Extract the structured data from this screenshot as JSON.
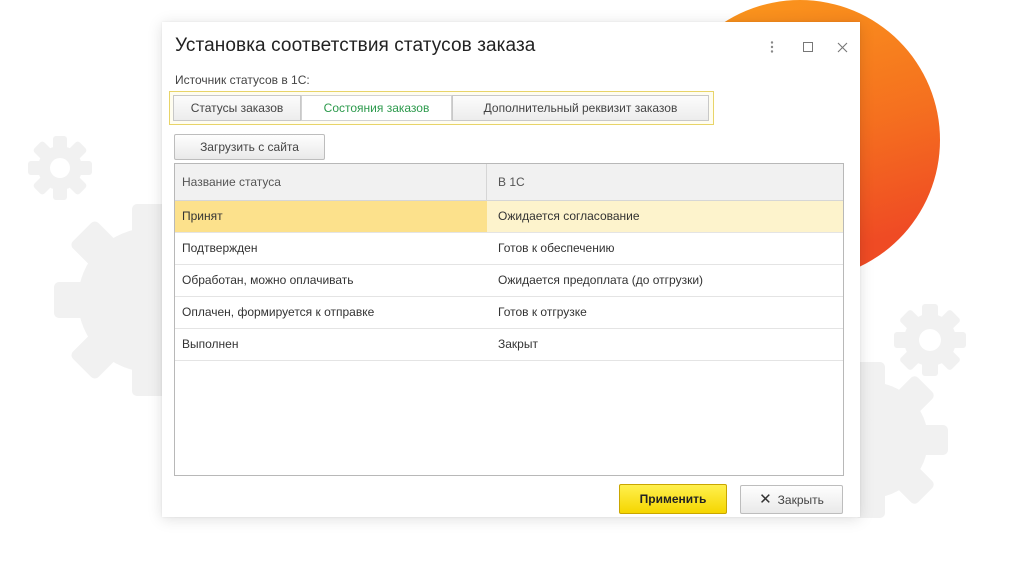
{
  "window": {
    "title": "Установка соответствия статусов заказа"
  },
  "source": {
    "label": "Источник статусов в 1С:",
    "options": [
      {
        "label": "Статусы заказов",
        "active": false
      },
      {
        "label": "Состояния заказов",
        "active": true
      },
      {
        "label": "Дополнительный реквизит заказов",
        "active": false
      }
    ]
  },
  "toolbar": {
    "load_label": "Загрузить с сайта"
  },
  "table": {
    "columns": [
      "Название статуса",
      "В 1С"
    ],
    "rows": [
      {
        "name": "Принят",
        "value": "Ожидается согласование",
        "selected": true
      },
      {
        "name": "Подтвержден",
        "value": "Готов к обеспечению",
        "selected": false
      },
      {
        "name": "Обработан, можно оплачивать",
        "value": "Ожидается предоплата (до отгрузки)",
        "selected": false
      },
      {
        "name": "Оплачен, формируется к отправке",
        "value": "Готов к отгрузке",
        "selected": false
      },
      {
        "name": "Выполнен",
        "value": "Закрыт",
        "selected": false
      }
    ]
  },
  "footer": {
    "apply_label": "Применить",
    "close_label": "Закрыть"
  },
  "colors": {
    "accent_orange": "#f4731f",
    "apply_yellow": "#f8dc14",
    "active_tab_green": "#2c9a4c",
    "selected_row": "#fce18c"
  },
  "icons": {
    "more": "more-vertical-icon",
    "maximize": "maximize-icon",
    "close": "close-icon",
    "close_button": "close-x-icon"
  }
}
